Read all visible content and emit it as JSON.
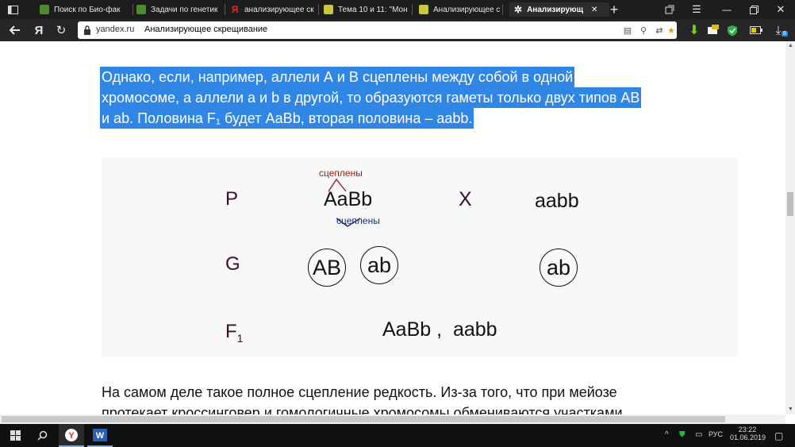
{
  "tabs": [
    {
      "label": "Поиск по Био-фак",
      "favicon_color": "#4e8a2e"
    },
    {
      "label": "Задачи по генетик",
      "favicon_color": "#4e8a2e"
    },
    {
      "label": "анализирующее ск",
      "favicon_color": "#e22b2b"
    },
    {
      "label": "Тема 10 и 11: \"Мон",
      "favicon_color": "#c9c93a"
    },
    {
      "label": "Анализирующее с",
      "favicon_color": "#c9c93a"
    },
    {
      "label": "Анализирующ",
      "favicon_color": "#dddddd"
    }
  ],
  "address": {
    "domain": "yandex.ru",
    "page_title": "Анализирующее скрещивание"
  },
  "highlighted_lines": [
    "Однако, если, например, аллели А и В сцеплены между собой в одной",
    "хромосоме, а аллели а и b в другой, то образуются гаметы только двух типов АВ",
    "и аb. Половина F₁ будет АаВb, вторая половина – ааbb."
  ],
  "figure": {
    "row_labels": {
      "p": "P",
      "g": "G",
      "f": "F"
    },
    "f_subscript": "1",
    "top_link_label": "сцеплены",
    "bottom_link_label": "сцеплены",
    "parent1": "AaBb",
    "cross_sign": "X",
    "parent2": "aabb",
    "gametes_left": [
      "AB",
      "ab"
    ],
    "gamete_right": "ab",
    "offspring": "AaBb ,  aabb",
    "colors": {
      "top_label": "#9b1b1b",
      "bottom_label": "#1a2a7a",
      "row_label": "#3a0d2a"
    }
  },
  "paragraph2": [
    "На самом деле такое полное сцепление редкость. Из-за того, что при мейозе",
    "протекает кроссинговер и гомологичные хромосомы обмениваются участками"
  ],
  "taskbar": {
    "lang": "РУС",
    "time": "23:22",
    "date": "01.06.2019"
  },
  "download_count": "8"
}
